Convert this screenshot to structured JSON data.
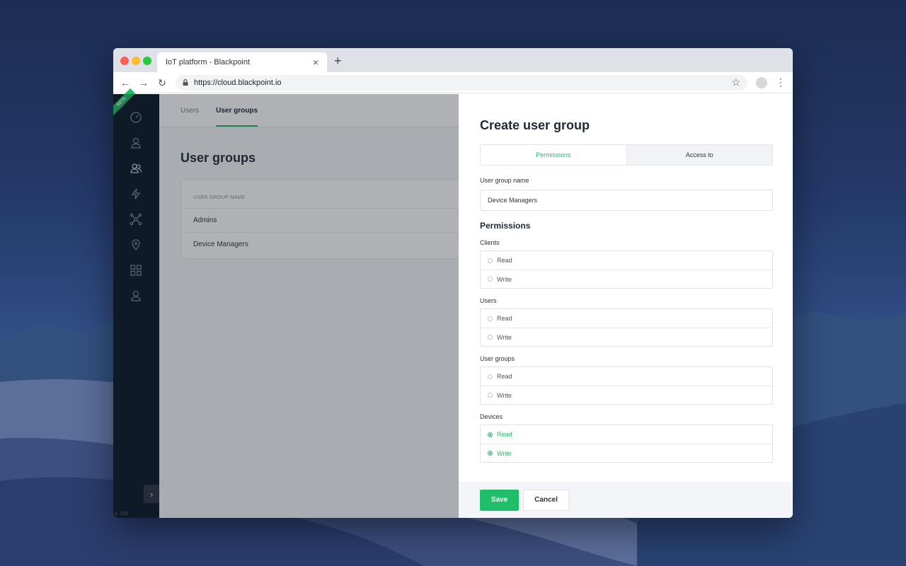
{
  "browser": {
    "tab_title": "IoT platform - Blackpoint",
    "tab_close": "×",
    "new_tab": "+",
    "url": "https://cloud.blackpoint.io",
    "back": "←",
    "forward": "→",
    "reload": "↻",
    "bookmark": "☆",
    "menu": "⋮"
  },
  "sidebar": {
    "badge": "BETA",
    "icons": [
      "dashboard-icon",
      "user-icon",
      "users-icon",
      "bolt-icon",
      "network-icon",
      "location-pin-icon",
      "grid-icon",
      "account-icon"
    ],
    "collapse": "›",
    "version": "v. 216"
  },
  "topnav": {
    "tabs": [
      "Users",
      "User groups"
    ],
    "active": "User groups"
  },
  "page": {
    "title": "User groups",
    "table_header": "USER GROUP NAME",
    "rows": [
      "Admins",
      "Device Managers"
    ]
  },
  "drawer": {
    "title": "Create user group",
    "tabs": [
      "Permissions",
      "Access to"
    ],
    "name_label": "User group name",
    "name_value": "Device Managers",
    "permissions_title": "Permissions",
    "groups": [
      {
        "label": "Clients",
        "options": [
          "Read",
          "Write"
        ],
        "selected": []
      },
      {
        "label": "Users",
        "options": [
          "Read",
          "Write"
        ],
        "selected": []
      },
      {
        "label": "User groups",
        "options": [
          "Read",
          "Write"
        ],
        "selected": []
      },
      {
        "label": "Devices",
        "options": [
          "Read",
          "Write"
        ],
        "selected": [
          "Read",
          "Write"
        ]
      }
    ],
    "save": "Save",
    "cancel": "Cancel"
  },
  "colors": {
    "accent": "#1fbf6a",
    "sidebar": "#0a1728"
  }
}
